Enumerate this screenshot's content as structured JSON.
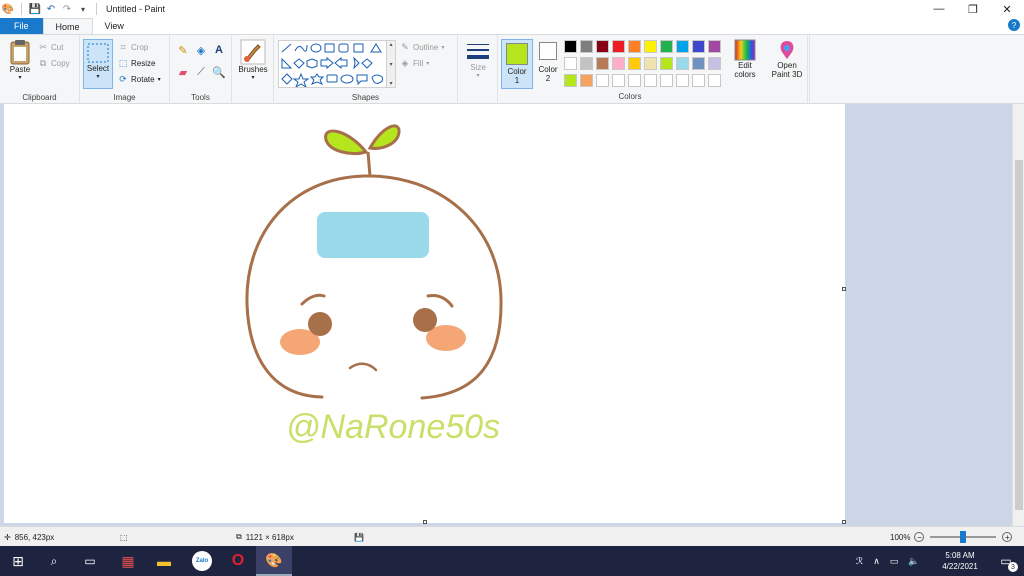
{
  "window": {
    "title": "Untitled - Paint",
    "minimize_icon": "minimize-icon",
    "maximize_icon": "restore-icon",
    "close_icon": "close-icon"
  },
  "tabs": {
    "file": "File",
    "home": "Home",
    "view": "View"
  },
  "help_icon": "?",
  "clipboard": {
    "paste": "Paste",
    "cut": "Cut",
    "copy": "Copy",
    "label": "Clipboard"
  },
  "image": {
    "select": "Select",
    "crop": "Crop",
    "resize": "Resize",
    "rotate": "Rotate",
    "label": "Image"
  },
  "tools": {
    "label": "Tools"
  },
  "brushes": {
    "label": "Brushes"
  },
  "shapes": {
    "outline": "Outline",
    "fill": "Fill",
    "label": "Shapes"
  },
  "size": {
    "label": "Size"
  },
  "colors": {
    "color1": "Color",
    "color1_num": "1",
    "color2": "Color",
    "color2_num": "2",
    "edit1": "Edit",
    "edit2": "colors",
    "paint3d1": "Open",
    "paint3d2": "Paint 3D",
    "label": "Colors",
    "color1_value": "#b5e61d",
    "color2_value": "#ffffff",
    "row1": [
      "#000000",
      "#7f7f7f",
      "#880015",
      "#ed1c24",
      "#ff7f27",
      "#fff200",
      "#22b14c",
      "#00a2e8",
      "#3f48cc",
      "#a349a4"
    ],
    "row2": [
      "#ffffff",
      "#c3c3c3",
      "#b97a57",
      "#ffaec9",
      "#ffc90e",
      "#efe4b0",
      "#b5e61d",
      "#99d9ea",
      "#7092be",
      "#c8bfe7"
    ],
    "row3": [
      "#b5e61d",
      "#f4a460",
      "#ffffff",
      "#ffffff",
      "#ffffff",
      "#ffffff",
      "#ffffff",
      "#ffffff",
      "#ffffff",
      "#ffffff"
    ]
  },
  "drawing": {
    "text": "@NaRone50s",
    "outline_color": "#a8704a",
    "leaf_color": "#b5e61d",
    "band_color": "#99d9ea",
    "cheek_color": "#f4a674",
    "eye_color": "#a8704a",
    "text_color": "#c8e06a"
  },
  "status": {
    "cursor": "856, 423px",
    "canvas_size": "1121 × 618px",
    "zoom": "100%"
  },
  "taskbar": {
    "time": "5:08 AM",
    "date": "4/22/2021",
    "notification_count": "3",
    "zalo_label": "Zalo"
  }
}
